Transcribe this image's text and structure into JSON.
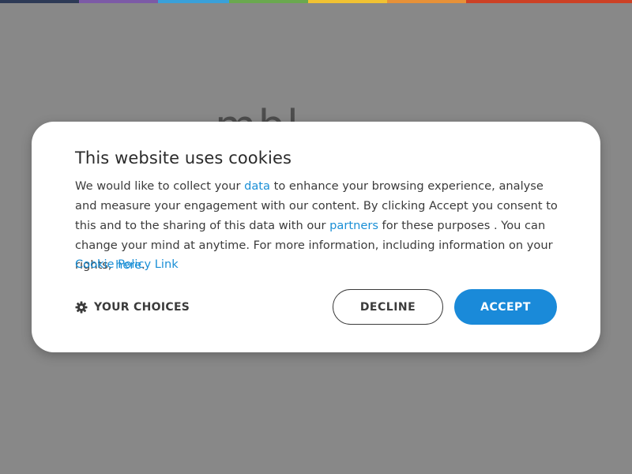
{
  "page": {
    "background_color": "#888888",
    "top_stripe_colors": [
      "#2d3a56",
      "#7c5aa6",
      "#3aa0d9",
      "#6aa84f",
      "#f1c232",
      "#e69138",
      "#cc4125"
    ],
    "background_logo_text": "mbl"
  },
  "cookie_modal": {
    "title": "This website uses cookies",
    "body": {
      "part1": "We would like to collect your ",
      "link_data": "data",
      "part2": " to enhance your browsing experience, analyse and measure your engagement with our content. By clicking Accept you consent to this and to the sharing of this data with our ",
      "link_partners": "partners",
      "part3": " for these purposes . You can change your mind at anytime. For more information, including information on your rights, ",
      "link_here": "here",
      "part4": "."
    },
    "cookie_policy_link": "Cookie Policy Link",
    "your_choices": {
      "label": "YOUR CHOICES",
      "icon": "gear-icon"
    },
    "decline_label": "DECLINE",
    "accept_label": "ACCEPT",
    "colors": {
      "link": "#1a8fd6",
      "accept_button": "#1a8ad9",
      "text": "#3b3b3b"
    }
  }
}
